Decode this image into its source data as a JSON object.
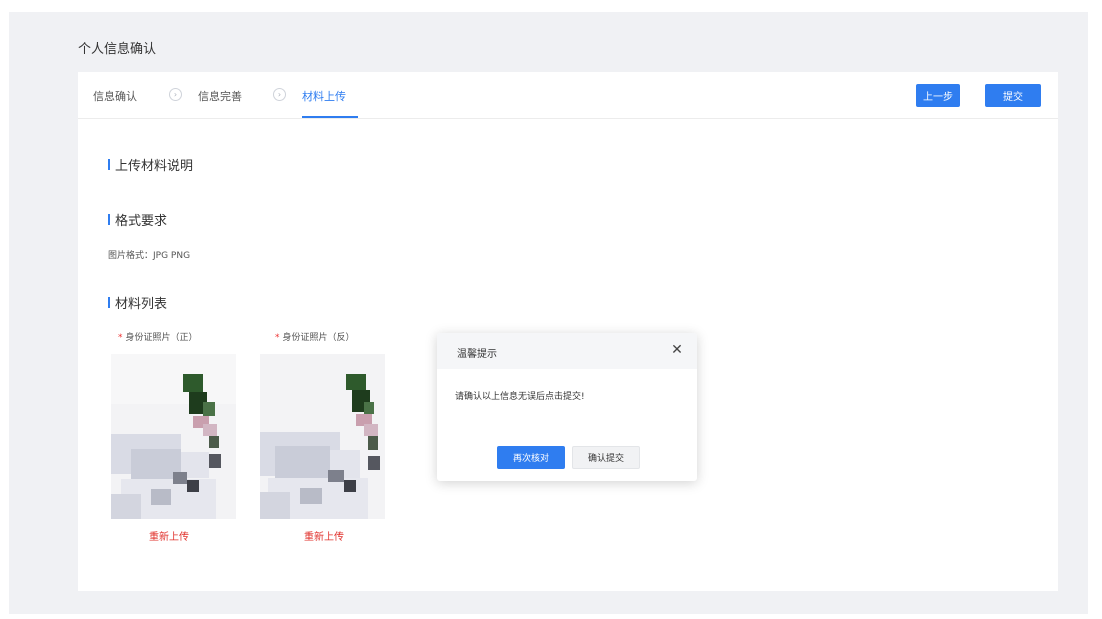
{
  "page": {
    "title": "个人信息确认"
  },
  "steps": [
    {
      "label": "信息确认"
    },
    {
      "label": "信息完善"
    },
    {
      "label": "材料上传"
    }
  ],
  "step_separator_icon": "chevron-right-circle-icon",
  "toolbar": {
    "prev_label": "上一步",
    "submit_label": "提交"
  },
  "sections": {
    "upload_desc": {
      "title": "上传材料说明"
    },
    "format": {
      "title": "格式要求",
      "text": "图片格式：JPG PNG"
    },
    "materials": {
      "title": "材料列表",
      "items": [
        {
          "label": "身份证照片（正）",
          "required_mark": "*",
          "action": "重新上传"
        },
        {
          "label": "身份证照片（反）",
          "required_mark": "*",
          "action": "重新上传"
        }
      ]
    }
  },
  "dialog": {
    "title": "温馨提示",
    "message": "请确认以上信息无误后点击提交!",
    "primary_label": "再次核对",
    "secondary_label": "确认提交",
    "close_icon": "close-icon"
  },
  "colors": {
    "accent": "#2f7df0",
    "danger": "#e0302b",
    "background": "#f0f1f4"
  }
}
